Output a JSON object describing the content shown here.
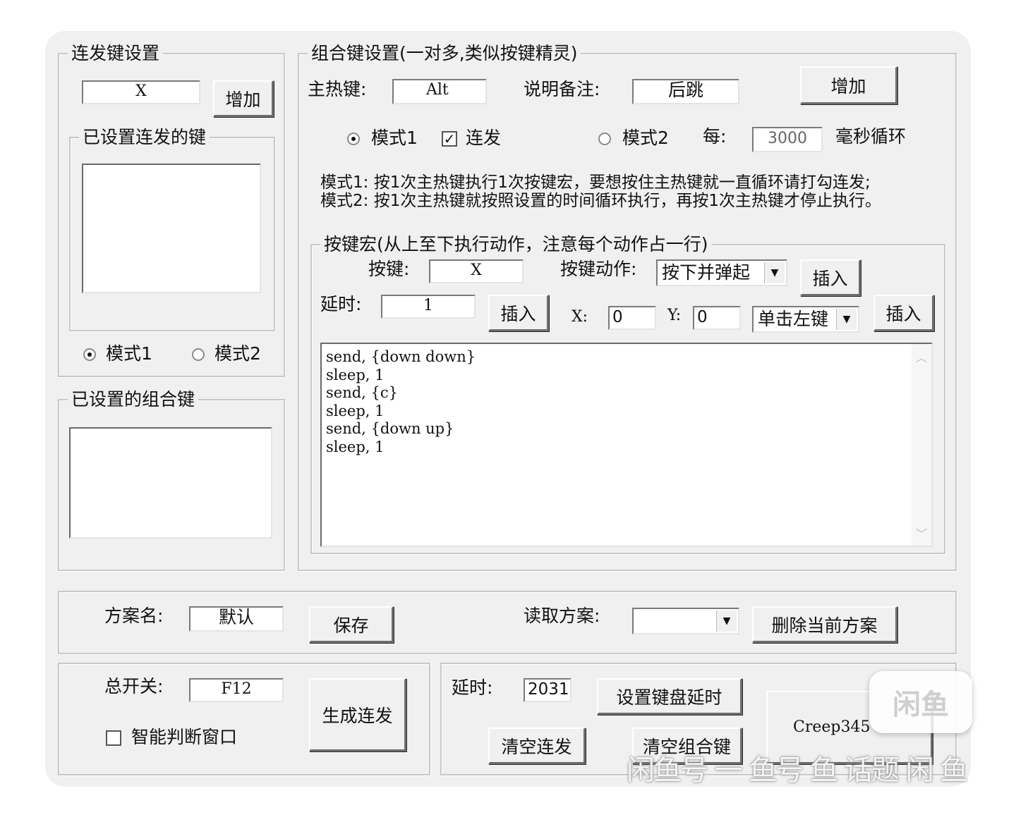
{
  "rapid": {
    "title": "连发键设置",
    "key_value": "X",
    "add_label": "增加",
    "set_keys_title": "已设置连发的键",
    "mode1": "模式1",
    "mode2": "模式2"
  },
  "combo_list": {
    "title": "已设置的组合键"
  },
  "combo": {
    "title": "组合键设置(一对多,类似按键精灵)",
    "hotkey_label": "主热键:",
    "hotkey_value": "Alt",
    "note_label": "说明备注:",
    "note_value": "后跳",
    "add_label": "增加",
    "mode1": "模式1",
    "repeat_label": "连发",
    "mode2": "模式2",
    "every_label": "每:",
    "interval_value": "3000",
    "ms_loop_label": "毫秒循环",
    "desc1": "模式1: 按1次主热键执行1次按键宏，要想按住主热键就一直循环请打勾连发;",
    "desc2": "模式2: 按1次主热键就按照设置的时间循环执行，再按1次主热键才停止执行。"
  },
  "macro": {
    "title": "按键宏(从上至下执行动作，注意每个动作占一行)",
    "key_label": "按键:",
    "key_value": "X",
    "action_label": "按键动作:",
    "action_value": "按下并弹起",
    "insert_label": "插入",
    "delay_label": "延时:",
    "delay_value": "1",
    "x_label": "X:",
    "x_value": "0",
    "y_label": "Y:",
    "y_value": "0",
    "click_value": "单击左键",
    "lines": [
      "send, {down down}",
      "sleep, 1",
      "send, {c}",
      "sleep, 1",
      "send, {down up}",
      "sleep, 1"
    ]
  },
  "scheme": {
    "name_label": "方案名:",
    "name_value": "默认",
    "save_label": "保存",
    "load_label": "读取方案:",
    "load_value": "",
    "delete_label": "删除当前方案"
  },
  "master": {
    "label": "总开关:",
    "value": "F12",
    "smart_label": "智能判断窗口",
    "generate_label": "生成连发"
  },
  "bottom": {
    "delay_label": "延时:",
    "delay_value": "2031",
    "set_delay_label": "设置键盘延时",
    "clear_rapid_label": "清空连发",
    "clear_combo_label": "清空组合键",
    "credit_label": "Creep345"
  },
  "watermark": {
    "logo": "闲鱼",
    "text": "闲鱼号 一 鱼号 鱼 话题 闲 鱼"
  }
}
